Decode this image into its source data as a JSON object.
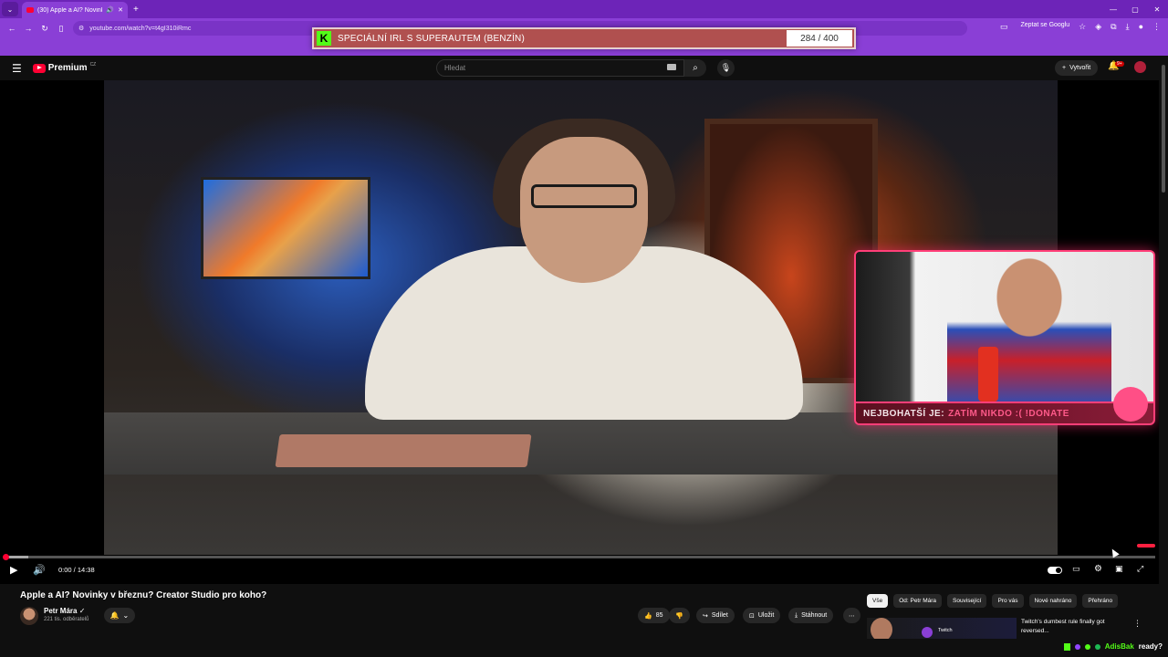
{
  "browser": {
    "tab_title": "(30) Apple a AI? Novinky v",
    "url": "youtube.com/watch?v=t4gI310iRmc",
    "ask_google": "Zeptat se Googlu"
  },
  "overlay": {
    "goal_text": "SPECIÁLNÍ IRL S SUPERAUTEM (BENZÍN)",
    "goal_count": "284 / 400",
    "banner_label": "NEJBOHATŠÍ JE:",
    "banner_value": "ZATÍM NIKDO :( !DONATE"
  },
  "yt": {
    "brand": "Premium",
    "region": "CZ",
    "search_placeholder": "Hledat",
    "create_label": "Vytvořit",
    "notif_badge": "9+"
  },
  "player": {
    "time": "0:00 / 14:38",
    "progress_fraction": 0.02
  },
  "video": {
    "title": "Apple a AI? Novinky v březnu? Creator Studio pro koho?",
    "channel": "Petr Mára",
    "subscribers": "221 tis. odběratelů",
    "likes": "85",
    "share": "Sdílet",
    "save": "Uložit",
    "download": "Stáhnout"
  },
  "chips": [
    "Vše",
    "Od: Petr Mára",
    "Související",
    "Pro vás",
    "Nové nahráno",
    "Přehráno"
  ],
  "recommendation": {
    "title": "Twitch's dumbest rule finally got reversed...",
    "thumb_label": "Twitch"
  },
  "taskbar": {
    "user": "AdisBak",
    "status": "ready?"
  },
  "colors": {
    "browser_purple": "#8a3fd6",
    "yt_red": "#ff0033",
    "overlay_pink": "#ff3e78",
    "kick_green": "#53fc18"
  }
}
